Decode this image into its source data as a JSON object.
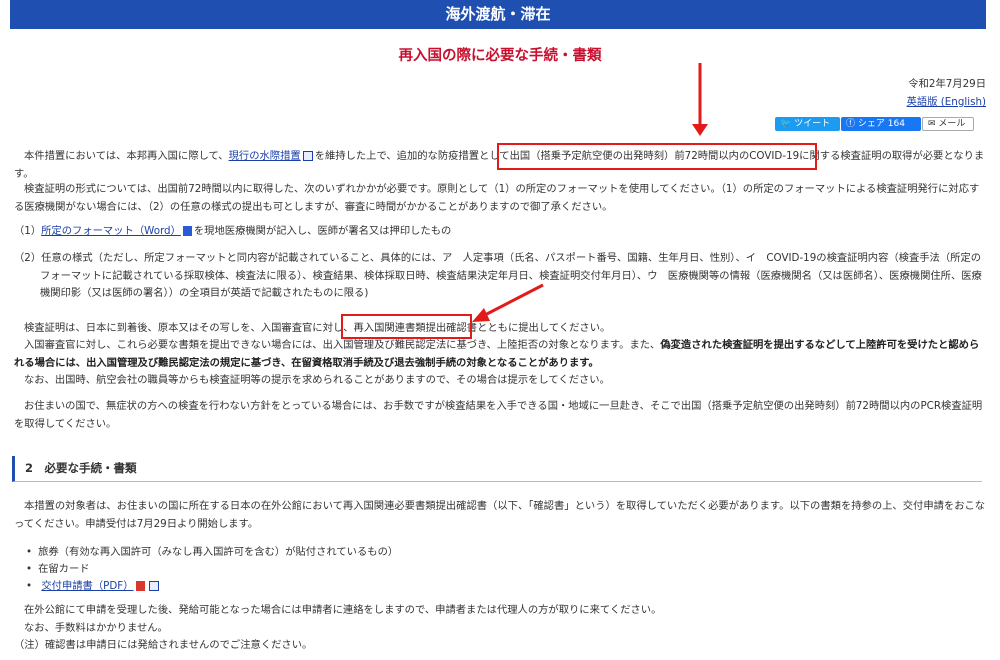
{
  "header": {
    "section": "海外渡航・滞在"
  },
  "page": {
    "title": "再入国の際に必要な手続・書類",
    "date": "令和2年7月29日",
    "english_link": "英語版 (English)",
    "share": {
      "tweet": "ツイート",
      "facebook": "シェア 164",
      "mail": "メール"
    }
  },
  "body": {
    "p1_pre": "本件措置においては、本邦再入国に際して、",
    "p1_link": "現行の水際措置",
    "p1_mid": "を維持した上で、追加的な防疫措置として",
    "p1_highlight": "出国（搭乗予定航空便の出発時刻）前72時間以内のCOVID-19に関する検査証明",
    "p1_post": "の取得が必要となります。",
    "p2": "検査証明の形式については、出国前72時間以内に取得した、次のいずれかかが必要です。原則として（1）の所定のフォーマットを使用してください。（1）の所定のフォーマットによる検査証明発行に対応する医療機関がない場合には、（2）の任意の様式の提出も可としますが、審査に時間がかかることがありますので御了承ください。",
    "item1_pre": "（1）",
    "item1_link": "所定のフォーマット（Word）",
    "item1_post": "を現地医療機関が記入し、医師が署名又は押印したもの",
    "item2": "（2）任意の様式（ただし、所定フォーマットと同内容が記載されていること、具体的には、ア　人定事項（氏名、パスポート番号、国籍、生年月日、性別）、イ　COVID-19の検査証明内容（検査手法（所定のフォーマットに記載されている採取検体、検査法に限る）、検査結果、検体採取日時、検査結果決定年月日、検査証明交付年月日）、ウ　医療機関等の情報（医療機関名（又は医師名）、医療機関住所、医療機関印影（又は医師の署名））の全項目が英語で記載されたものに限る)",
    "p3_pre": "検査証明は、日本に到着後、原本又はその写しを、入国審査官に対し、",
    "p3_highlight": "再入国関連書類提出確認書",
    "p3_post": "とともに提出してください。",
    "p4_pre": "入国審査官に対し、これら必要な書類を提出できない場合には、出入国管理及び難民認定法に基づき、上陸拒否の対象となります。また、",
    "p4_bold": "偽変造された検査証明を提出するなどして上陸許可を受けたと認められる場合には、出入国管理及び難民認定法の規定に基づき、在留資格取消手続及び退去強制手続の対象となることがあります。",
    "p5": "なお、出国時、航空会社の職員等からも検査証明等の提示を求められることがありますので、その場合は提示をしてください。",
    "p6": "お住まいの国で、無症状の方への検査を行わない方針をとっている場合には、お手数ですが検査結果を入手できる国・地域に一旦赴き、そこで出国（搭乗予定航空便の出発時刻）前72時間以内のPCR検査証明を取得してください。",
    "section2_title": "2　必要な手続・書類",
    "p7": "本措置の対象者は、お住まいの国に所在する日本の在外公館において再入国関連必要書類提出確認書（以下、「確認書」という）を取得していただく必要があります。以下の書類を持参の上、交付申請をおこなってください。申請受付は7月29日より開始します。",
    "bullets": [
      "旅券（有効な再入国許可（みなし再入国許可を含む）が貼付されているもの）",
      "在留カード"
    ],
    "bullet_link": "交付申請書（PDF）",
    "p8": "在外公館にて申請を受理した後、発給可能となった場合には申請者に連絡をしますので、申請者または代理人の方が取りに来てください。",
    "p9": "なお、手数料はかかりません。",
    "p10": "（注）確認書は申請日には発給されませんのでご注意ください。"
  },
  "colors": {
    "header_bg": "#1f4fb0",
    "title": "#c8102e",
    "highlight_box": "#e21a1a",
    "link": "#1a3fa8"
  }
}
